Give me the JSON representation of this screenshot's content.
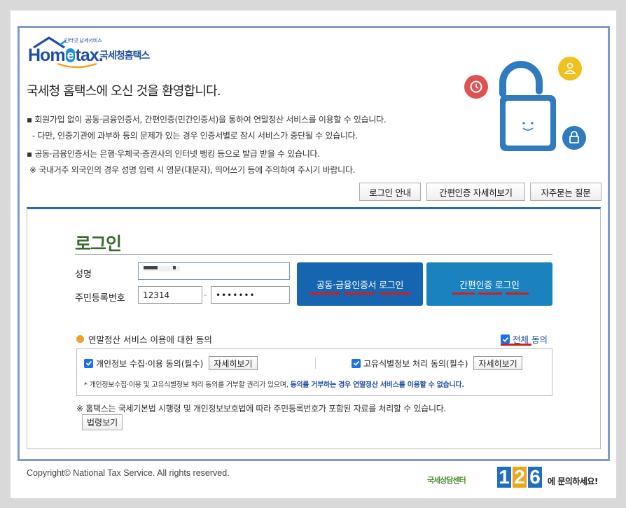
{
  "logo": {
    "brand": "Hometax",
    "tagline": "인터넷 납세서비스",
    "name": "국세청홈택스"
  },
  "welcome": "국세청 홈택스에 오신 것을 환영합니다.",
  "info": [
    "▪ 회원가입 없이 공동·금융인증서, 간편인증(민간인증서)을 통하여 연말정산 서비스를 이용할 수 있습니다.",
    "- 다만, 인증기관에 과부하 등의 문제가 있는 경우 인증서별로 잠시 서비스가 중단될 수 있습니다.",
    "▪ 공동·금융인증서는 은행·우체국·증권사의 인터넷 뱅킹 등으로 발급 받을 수 있습니다.",
    "※ 국내거주 외국인의 경우 성명 입력 시 영문(대문자), 띄어쓰기 등에 주의하여 주시기 바랍니다."
  ],
  "top_buttons": {
    "login_guide": "로그인 안내",
    "simple_auth_detail": "간편인증 자세히보기",
    "faq": "자주묻는 질문"
  },
  "login": {
    "title": "로그인",
    "name_label": "성명",
    "name_value": "",
    "rrn_label": "주민등록번호",
    "rrn_front": "12314",
    "rrn_sep": "-",
    "rrn_back": "•••••••",
    "cert_login": "공동·금융인증서 로그인",
    "simple_login": "간편인증 로그인"
  },
  "agreement": {
    "title": "연말정산 서비스 이용에 대한 동의",
    "all_agree": "전체 동의",
    "item1": "개인정보 수집·이용 동의(필수)",
    "item2": "고유식별정보 처리 동의(필수)",
    "detail_label": "자세히보기",
    "note_prefix": "* 개인정보수집·이용 및 고유식별정보 처리 동의를 거부할 권리가 있으며,",
    "note_bold": "동의를 거부하는 경우 연말정산 서비스를 이용할 수 없습니다."
  },
  "law": {
    "note": "※ 홈택스는 국세기본법 시행령 및 개인정보보호법에 따라 주민등록번호가 포함된 자료를 처리할 수 있습니다.",
    "button": "법령보기"
  },
  "footer": {
    "copyright": "Copyright© National Tax Service. All rights reserved.",
    "callcenter_pre": "국세상담센터",
    "callcenter_digits": [
      "1",
      "2",
      "6"
    ],
    "callcenter_post": "에 문의하세요!"
  },
  "colors": {
    "primary_blue": "#1565b0",
    "teal_blue": "#1a82bf",
    "title_green": "#3a6a2e",
    "underline_red": "#d81b1b",
    "frame_blue": "#7f9cc4",
    "callcenter_digits": [
      "#1f6fc1",
      "#f2a51a",
      "#1f6fc1"
    ]
  }
}
